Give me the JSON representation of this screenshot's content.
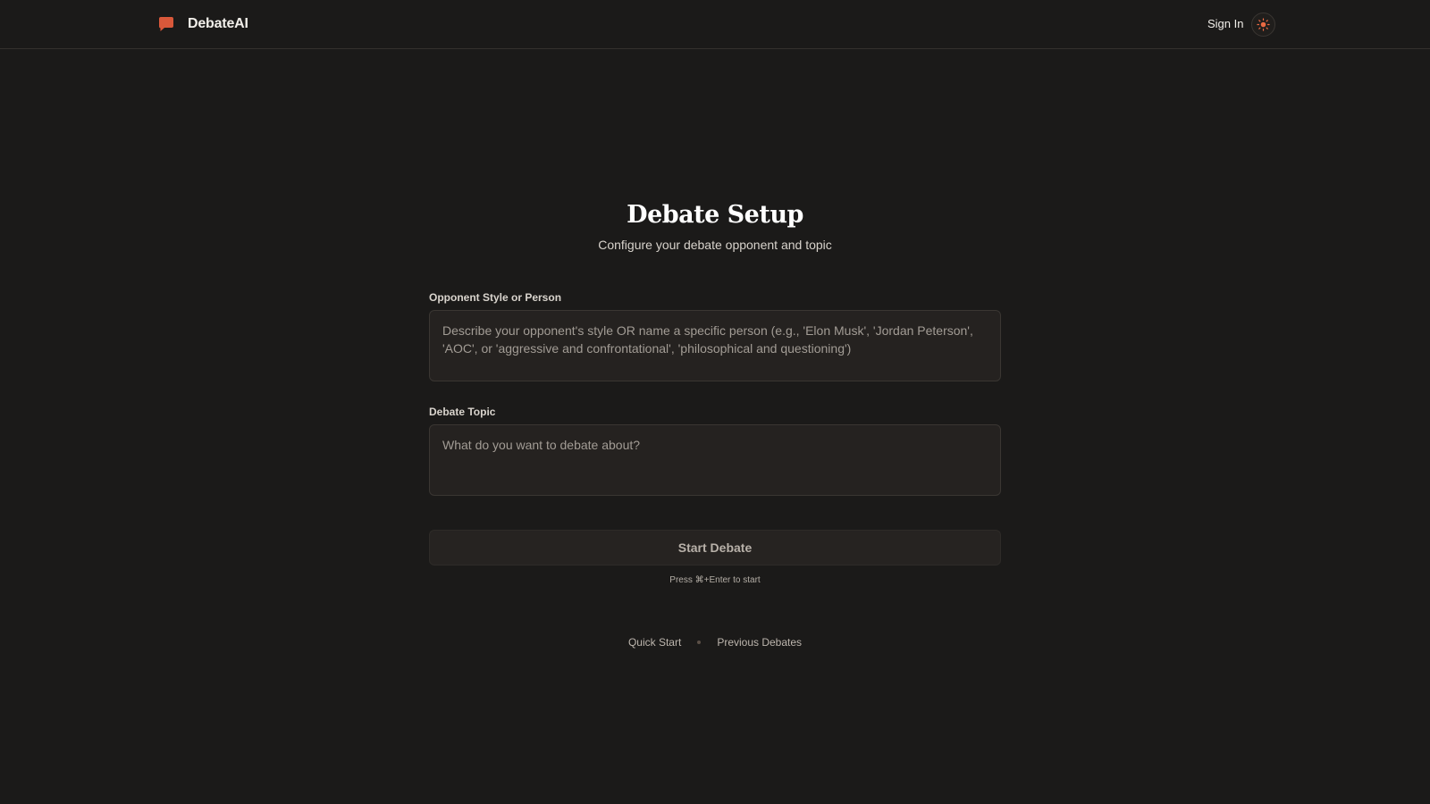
{
  "header": {
    "brand_name": "DebateAI",
    "brand_color": "#d9583a",
    "sign_in_label": "Sign In",
    "theme_toggle_icon": "sun-icon",
    "theme_icon_color": "#e96a43"
  },
  "setup": {
    "title": "Debate Setup",
    "subtitle": "Configure your debate opponent and topic",
    "opponent": {
      "label": "Opponent Style or Person",
      "value": "",
      "placeholder": "Describe your opponent's style OR name a specific person (e.g., 'Elon Musk', 'Jordan Peterson', 'AOC', or 'aggressive and confrontational', 'philosophical and questioning')"
    },
    "topic": {
      "label": "Debate Topic",
      "value": "",
      "placeholder": "What do you want to debate about?"
    },
    "start_button_label": "Start Debate",
    "shortcut_hint": "Press ⌘+Enter to start"
  },
  "footer": {
    "links": [
      "Quick Start",
      "Previous Debates"
    ]
  }
}
